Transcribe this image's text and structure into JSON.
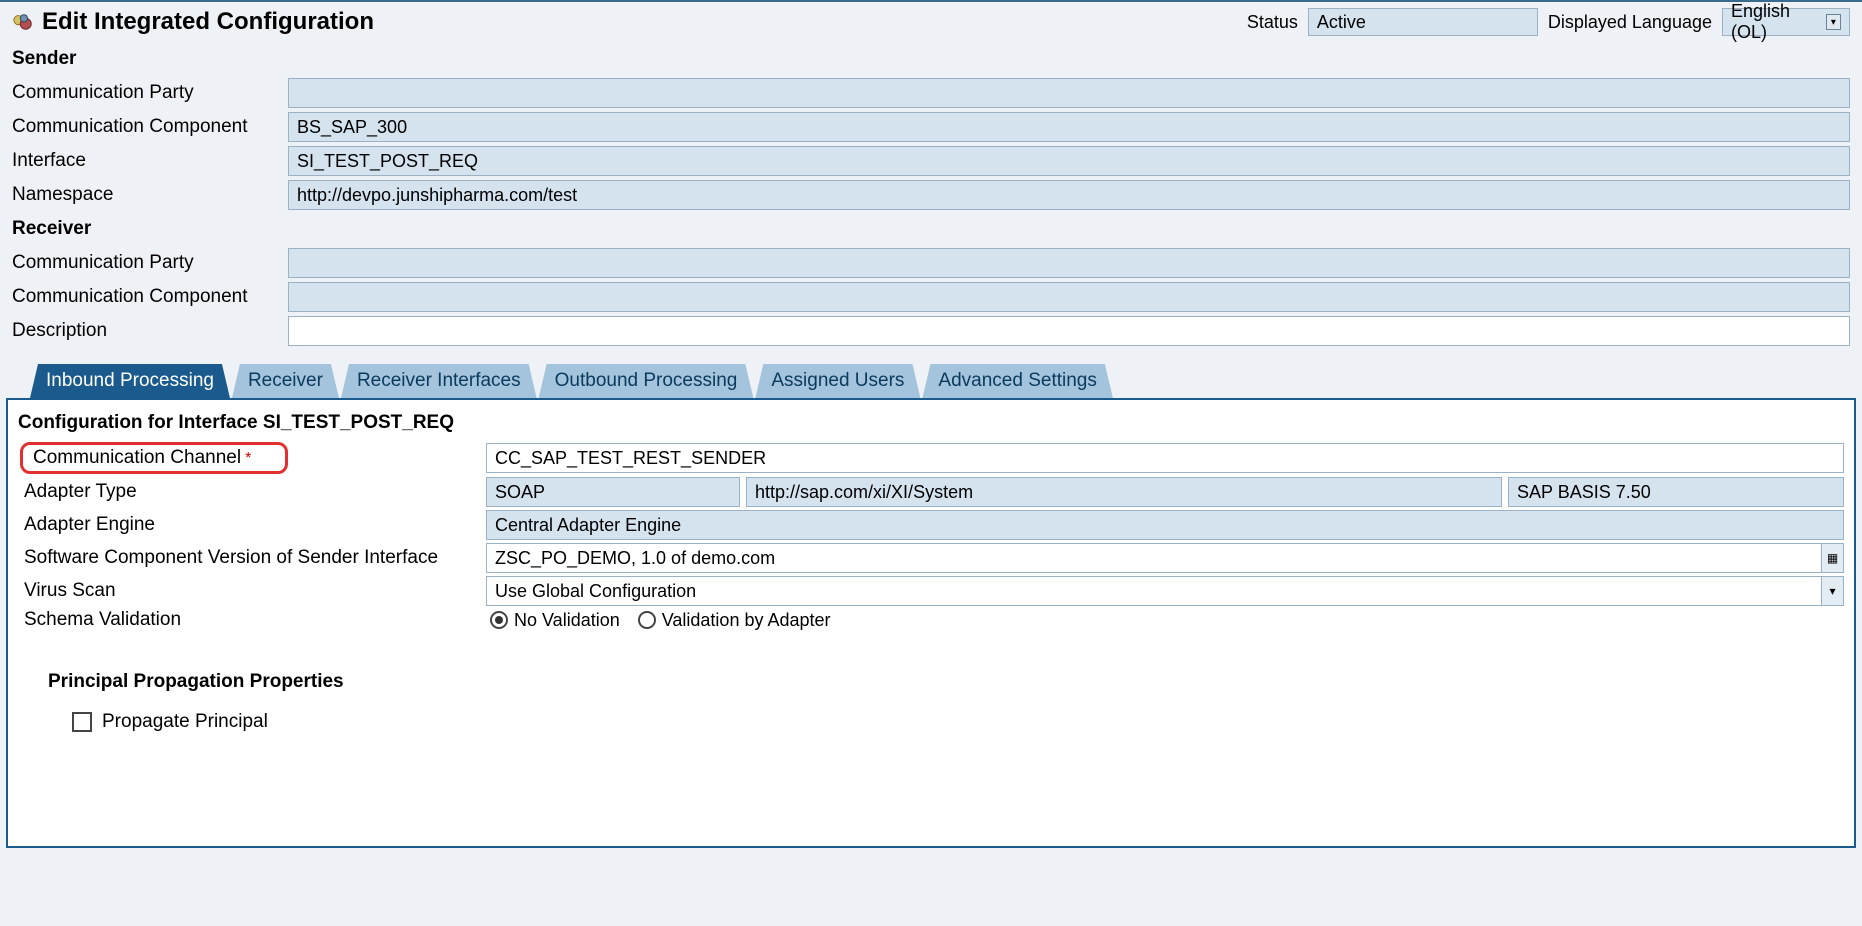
{
  "header": {
    "title": "Edit Integrated Configuration",
    "status_label": "Status",
    "status_value": "Active",
    "lang_label": "Displayed Language",
    "lang_value": "English (OL)"
  },
  "sender": {
    "heading": "Sender",
    "party_label": "Communication Party",
    "party_value": "",
    "component_label": "Communication Component",
    "component_value": "BS_SAP_300",
    "interface_label": "Interface",
    "interface_value": "SI_TEST_POST_REQ",
    "namespace_label": "Namespace",
    "namespace_value": "http://devpo.junshipharma.com/test"
  },
  "receiver": {
    "heading": "Receiver",
    "party_label": "Communication Party",
    "party_value": "",
    "component_label": "Communication Component",
    "component_value": ""
  },
  "description": {
    "label": "Description",
    "value": ""
  },
  "tabs": {
    "t0": "Inbound Processing",
    "t1": "Receiver",
    "t2": "Receiver Interfaces",
    "t3": "Outbound Processing",
    "t4": "Assigned Users",
    "t5": "Advanced Settings"
  },
  "config": {
    "heading": "Configuration for Interface SI_TEST_POST_REQ",
    "channel_label": "Communication Channel",
    "channel_value": "CC_SAP_TEST_REST_SENDER",
    "adapter_type_label": "Adapter Type",
    "adapter_type_val1": "SOAP",
    "adapter_type_val2": "http://sap.com/xi/XI/System",
    "adapter_type_val3": "SAP BASIS 7.50",
    "adapter_engine_label": "Adapter Engine",
    "adapter_engine_value": "Central Adapter Engine",
    "swcv_label": "Software Component Version of Sender Interface",
    "swcv_value": "ZSC_PO_DEMO, 1.0 of demo.com",
    "virus_label": "Virus Scan",
    "virus_value": "Use Global Configuration",
    "schema_label": "Schema Validation",
    "schema_opt1": "No Validation",
    "schema_opt2": "Validation by Adapter"
  },
  "propagation": {
    "heading": "Principal Propagation Properties",
    "checkbox_label": "Propagate Principal"
  }
}
